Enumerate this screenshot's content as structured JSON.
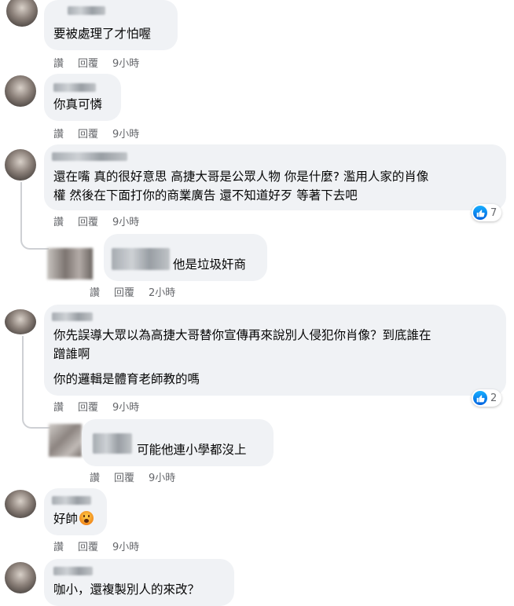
{
  "actions": {
    "like": "讚",
    "reply": "回覆"
  },
  "comments": [
    {
      "text": [
        "要被處理了才怕喔"
      ],
      "time": "9小時"
    },
    {
      "text": [
        "你真可憐"
      ],
      "time": "9小時"
    },
    {
      "text": [
        "還在嘴 真的很好意思 高捷大哥是公眾人物 你是什麼? 濫用人家的肖像",
        "權 然後在下面打你的商業廣告 還不知道好歹 等著下去吧"
      ],
      "time": "9小時",
      "likes": "7",
      "reply": {
        "text": "他是垃圾奸商",
        "time": "2小時"
      }
    },
    {
      "text": [
        "你先誤導大眾以為高捷大哥替你宣傳再來說別人侵犯你肖像？到底誰在",
        "蹭誰啊",
        "你的邏輯是體育老師教的嗎"
      ],
      "time": "9小時",
      "likes": "2",
      "reply": {
        "text": "可能他連小學都沒上",
        "time": "9小時"
      }
    },
    {
      "text": [
        "好帥"
      ],
      "time": "9小時"
    },
    {
      "text": [
        "咖小，還複製別人的來改？"
      ]
    }
  ],
  "colors": {
    "bubble": "#f0f2f5",
    "meta": "#65676b",
    "like_blue": "#0866ff"
  },
  "icons": {
    "like": "thumbs-up-icon",
    "wow": "wow-emoji-icon"
  }
}
